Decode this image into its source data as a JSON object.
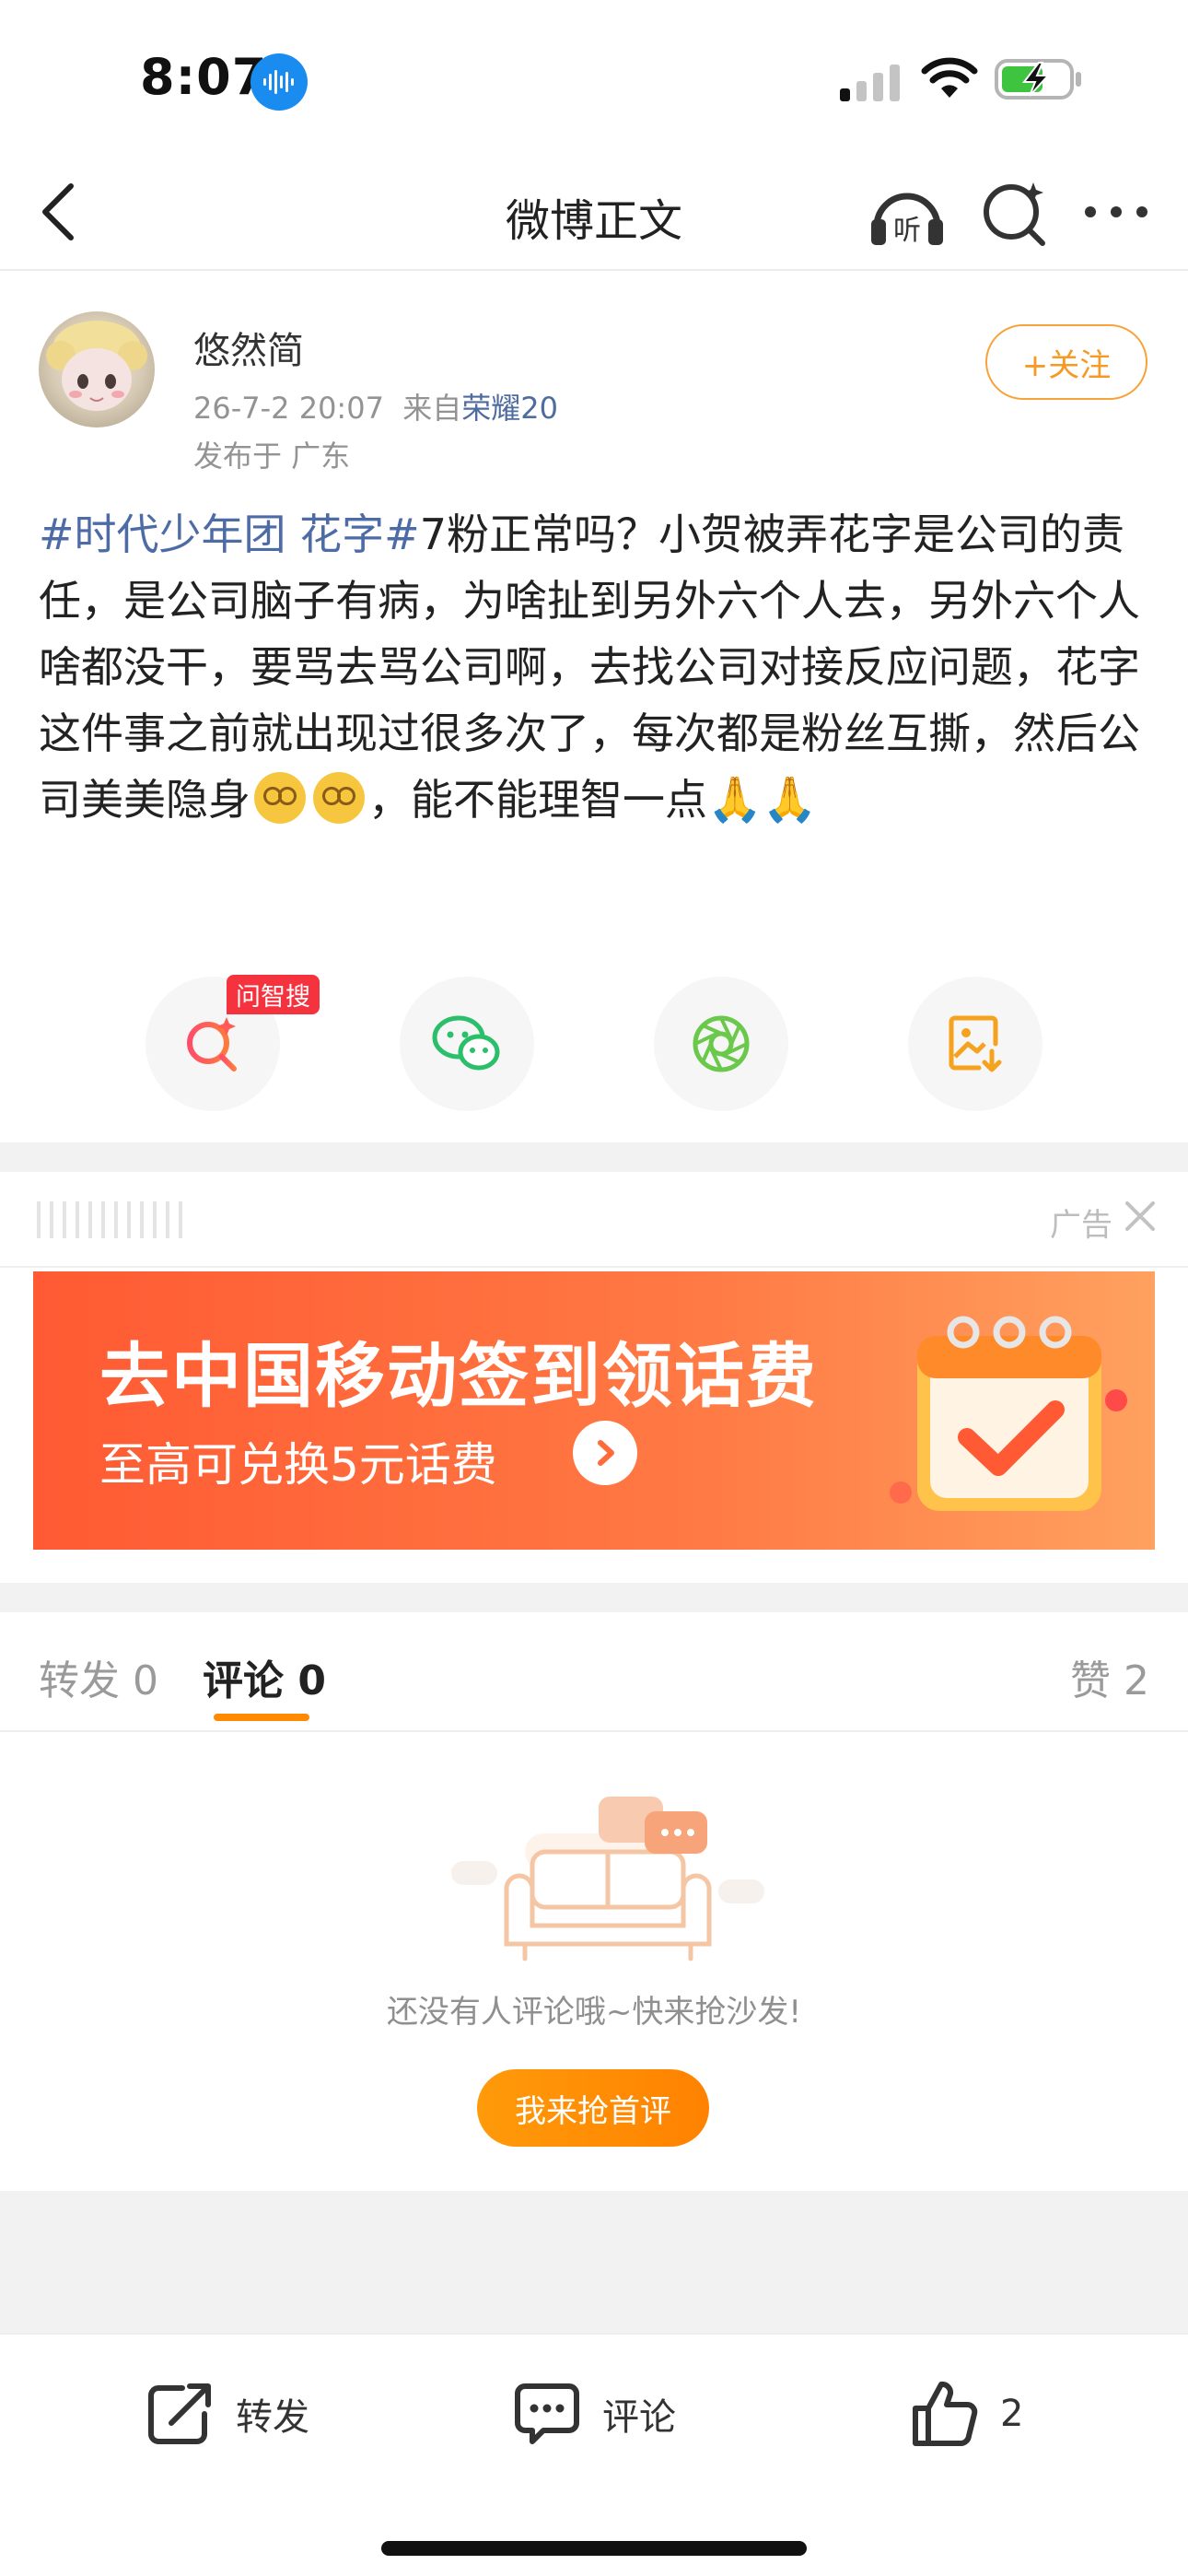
{
  "status_bar": {
    "time": "8:07"
  },
  "nav": {
    "title": "微博正文",
    "listen_glyph": "听"
  },
  "author": {
    "name": "悠然简",
    "date": "26-7-2 20:07",
    "source_prefix": "来自",
    "device": "荣耀20",
    "location": "发布于 广东",
    "follow_label": "+关注"
  },
  "post": {
    "topic": "#时代少年团 花字#",
    "text_part1": "7粉正常吗？小贺被弄花字是公司的责任，是公司脑子有病，为啥扯到另外六个人去，另外六个人啥都没干，要骂去骂公司啊，去找公司对接反应问题，花字这件事之前就出现过很多次了，每次都是粉丝互撕，然后公司美美隐身",
    "text_part2": "，能不能理智一点",
    "emojis": [
      "dizzy-face-emoji",
      "dizzy-face-emoji",
      "folded-hands-emoji",
      "folded-hands-emoji"
    ]
  },
  "share": {
    "ask_badge": "问智搜",
    "items": [
      "ask-search-icon",
      "wechat-icon",
      "moments-icon",
      "save-image-icon"
    ]
  },
  "ad": {
    "label": "广告",
    "title": "去中国移动签到领话费",
    "subtitle": "至高可兑换5元话费"
  },
  "tabs": {
    "repost": "转发 0",
    "comment": "评论 0",
    "like": "赞 2"
  },
  "empty": {
    "text": "还没有人评论哦~快来抢沙发!",
    "button": "我来抢首评"
  },
  "bottom": {
    "repost": "转发",
    "comment": "评论",
    "like_count": "2"
  },
  "colors": {
    "accent": "#ff8a00",
    "topic_blue": "#4d6ba4",
    "ad_orange": "#ff5a33"
  }
}
